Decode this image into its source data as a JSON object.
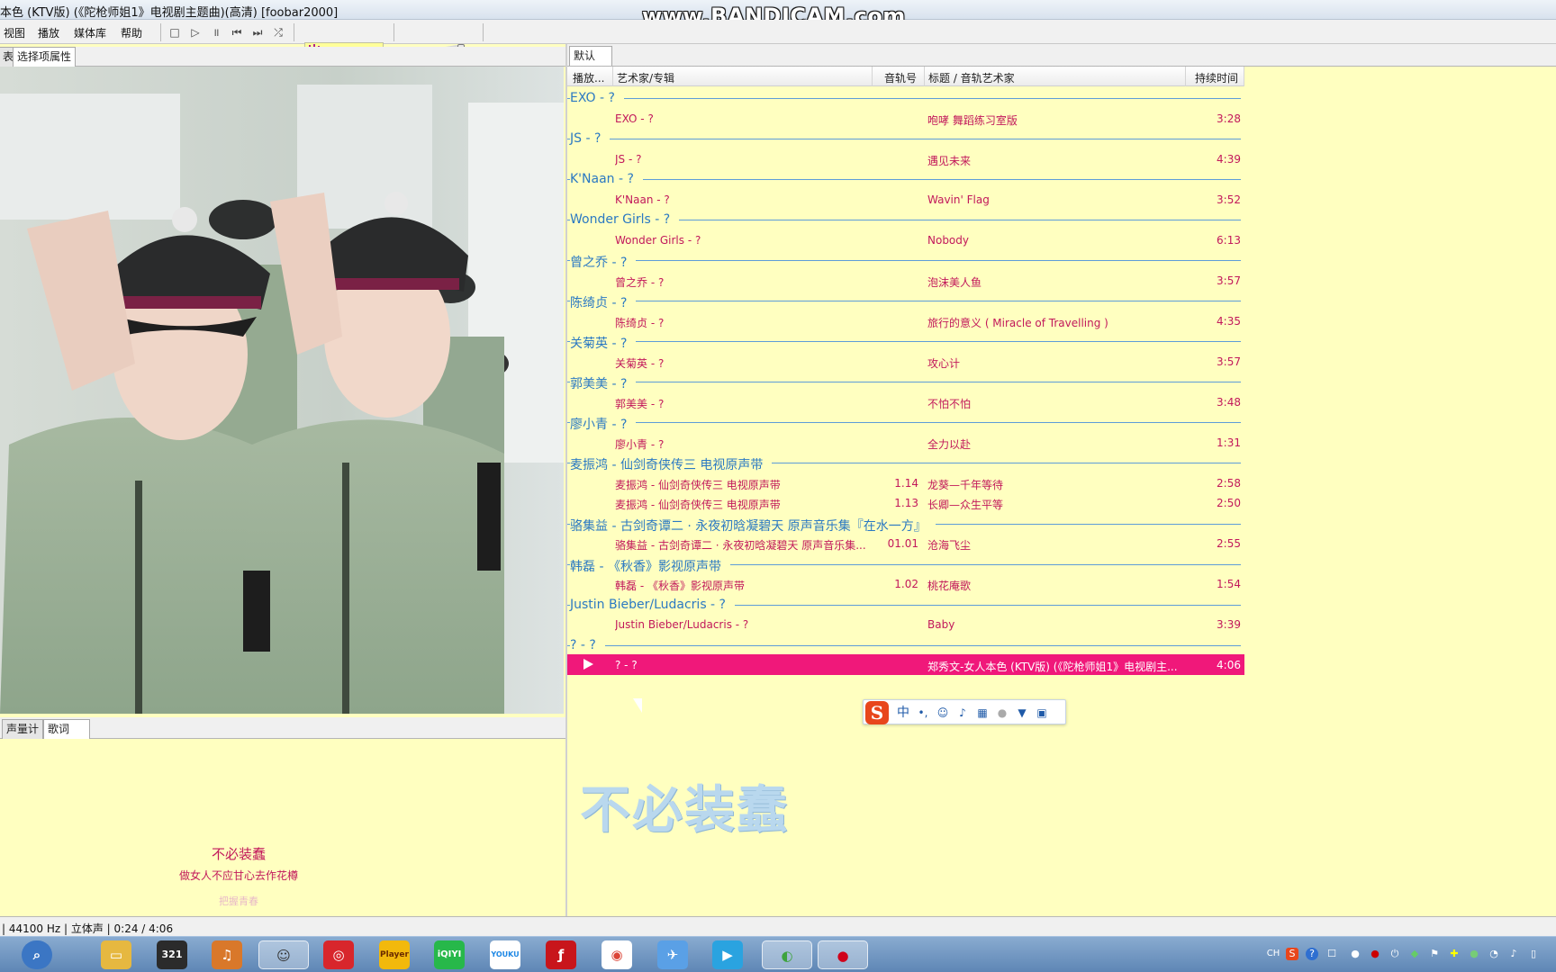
{
  "window": {
    "title": "本色 (KTV版) (《陀枪师姐1》电视剧主题曲)(高清)  [foobar2000]",
    "watermark": "www.BANDICAM.com"
  },
  "menu": [
    "视图",
    "播放",
    "媒体库",
    "帮助"
  ],
  "left_tabs": [
    "表",
    "选择项属性"
  ],
  "lower_tabs": [
    "声量计",
    "歌词"
  ],
  "lyrics": {
    "current": "不必装蠢",
    "next": "做女人不应甘心去作花樽",
    "faded": "把握青春"
  },
  "playlist_tab": "默认",
  "columns": {
    "playing": "播放...",
    "artist": "艺术家/专辑",
    "tracknum": "音轨号",
    "title": "标题 / 音轨艺术家",
    "duration": "持续时间"
  },
  "groups": [
    {
      "label": "EXO - ?",
      "tracks": [
        {
          "artist": "EXO - ?",
          "num": "",
          "title": "咆哮 舞蹈练习室版",
          "duration": "3:28"
        }
      ]
    },
    {
      "label": "JS - ?",
      "tracks": [
        {
          "artist": "JS - ?",
          "num": "",
          "title": "遇见未来",
          "duration": "4:39"
        }
      ]
    },
    {
      "label": "K'Naan - ?",
      "tracks": [
        {
          "artist": "K'Naan - ?",
          "num": "",
          "title": "Wavin' Flag",
          "duration": "3:52"
        }
      ]
    },
    {
      "label": "Wonder Girls - ?",
      "tracks": [
        {
          "artist": "Wonder Girls - ?",
          "num": "",
          "title": "Nobody",
          "duration": "6:13"
        }
      ]
    },
    {
      "label": "曾之乔 - ?",
      "tracks": [
        {
          "artist": "曾之乔 - ?",
          "num": "",
          "title": "泡沫美人鱼",
          "duration": "3:57"
        }
      ]
    },
    {
      "label": "陈绮贞 - ?",
      "tracks": [
        {
          "artist": "陈绮贞 - ?",
          "num": "",
          "title": "旅行的意义 ( Miracle of Travelling )",
          "duration": "4:35"
        }
      ]
    },
    {
      "label": "关菊英 - ?",
      "tracks": [
        {
          "artist": "关菊英 - ?",
          "num": "",
          "title": "攻心计",
          "duration": "3:57"
        }
      ]
    },
    {
      "label": "郭美美 - ?",
      "tracks": [
        {
          "artist": "郭美美 - ?",
          "num": "",
          "title": "不怕不怕",
          "duration": "3:48"
        }
      ]
    },
    {
      "label": "廖小青 - ?",
      "tracks": [
        {
          "artist": "廖小青 - ?",
          "num": "",
          "title": "全力以赴",
          "duration": "1:31"
        }
      ]
    },
    {
      "label": "麦振鸿 - 仙剑奇侠传三 电视原声带",
      "tracks": [
        {
          "artist": "麦振鸿 - 仙剑奇侠传三 电视原声带",
          "num": "1.14",
          "title": "龙葵—千年等待",
          "duration": "2:58"
        },
        {
          "artist": "麦振鸿 - 仙剑奇侠传三 电视原声带",
          "num": "1.13",
          "title": "长卿—众生平等",
          "duration": "2:50"
        }
      ]
    },
    {
      "label": "骆集益 - 古剑奇谭二 · 永夜初晗凝碧天 原声音乐集『在水一方』",
      "tracks": [
        {
          "artist": "骆集益 - 古剑奇谭二 · 永夜初晗凝碧天 原声音乐集...",
          "num": "01.01",
          "title": "沧海飞尘",
          "duration": "2:55"
        }
      ]
    },
    {
      "label": "韩磊 - 《秋香》影视原声带",
      "tracks": [
        {
          "artist": "韩磊 - 《秋香》影视原声带",
          "num": "1.02",
          "title": "桃花庵歌",
          "duration": "1:54"
        }
      ]
    },
    {
      "label": "Justin Bieber/Ludacris - ?",
      "tracks": [
        {
          "artist": "Justin Bieber/Ludacris - ?",
          "num": "",
          "title": "Baby",
          "duration": "3:39"
        }
      ]
    },
    {
      "label": "? - ?",
      "tracks": [
        {
          "artist": "? - ?",
          "num": "",
          "title": "郑秀文-女人本色 (KTV版) (《陀枪师姐1》电视剧主...",
          "duration": "4:06",
          "playing": true
        }
      ]
    }
  ],
  "big_lyric": "不必装蠢",
  "ime": {
    "mode": "中",
    "punct": "•,"
  },
  "status": "| 44100 Hz | 立体声 | 0:24 / 4:06",
  "colors": {
    "group": "#2b79c2",
    "track": "#c2185b",
    "playing_bg": "#f0187a",
    "background": "#ffffc0"
  },
  "taskbar": {
    "apps": [
      "start-orb",
      "search",
      "file-explorer",
      "media-player-classic",
      "headphones-player",
      "foobar2000",
      "netease-music",
      "kugou-player",
      "iqiyi",
      "youku",
      "flash",
      "chrome",
      "feige",
      "media-player",
      "sogou-browser",
      "bandicam"
    ],
    "labels": {
      "player": "Player",
      "iqiyi": "iQIYI",
      "youku": "YOUKU",
      "mpc": "321"
    },
    "tray_lang": "CH"
  }
}
